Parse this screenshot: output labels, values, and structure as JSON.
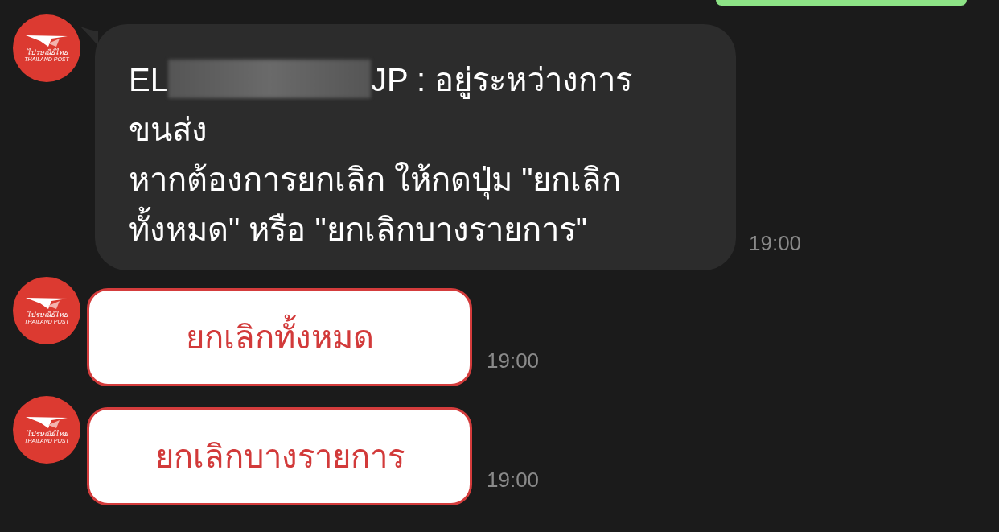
{
  "sent_bubble": {
    "kind": "partial"
  },
  "messages": [
    {
      "kind": "text",
      "avatar": {
        "name": "ไปรษณีย์ไทย",
        "subtitle": "THAILAND POST"
      },
      "text_before": "EL",
      "redacted": true,
      "text_after": "JP : อยู่ระหว่างการขนส่ง\nหากต้องการยกเลิก ให้กดปุ่ม \"ยกเลิกทั้งหมด\" หรือ \"ยกเลิกบางรายการ\"",
      "time": "19:00"
    },
    {
      "kind": "button",
      "avatar": {
        "name": "ไปรษณีย์ไทย",
        "subtitle": "THAILAND POST"
      },
      "label": "ยกเลิกทั้งหมด",
      "time": "19:00"
    },
    {
      "kind": "button",
      "avatar": {
        "name": "ไปรษณีย์ไทย",
        "subtitle": "THAILAND POST"
      },
      "label": "ยกเลิกบางรายการ",
      "time": "19:00"
    }
  ]
}
